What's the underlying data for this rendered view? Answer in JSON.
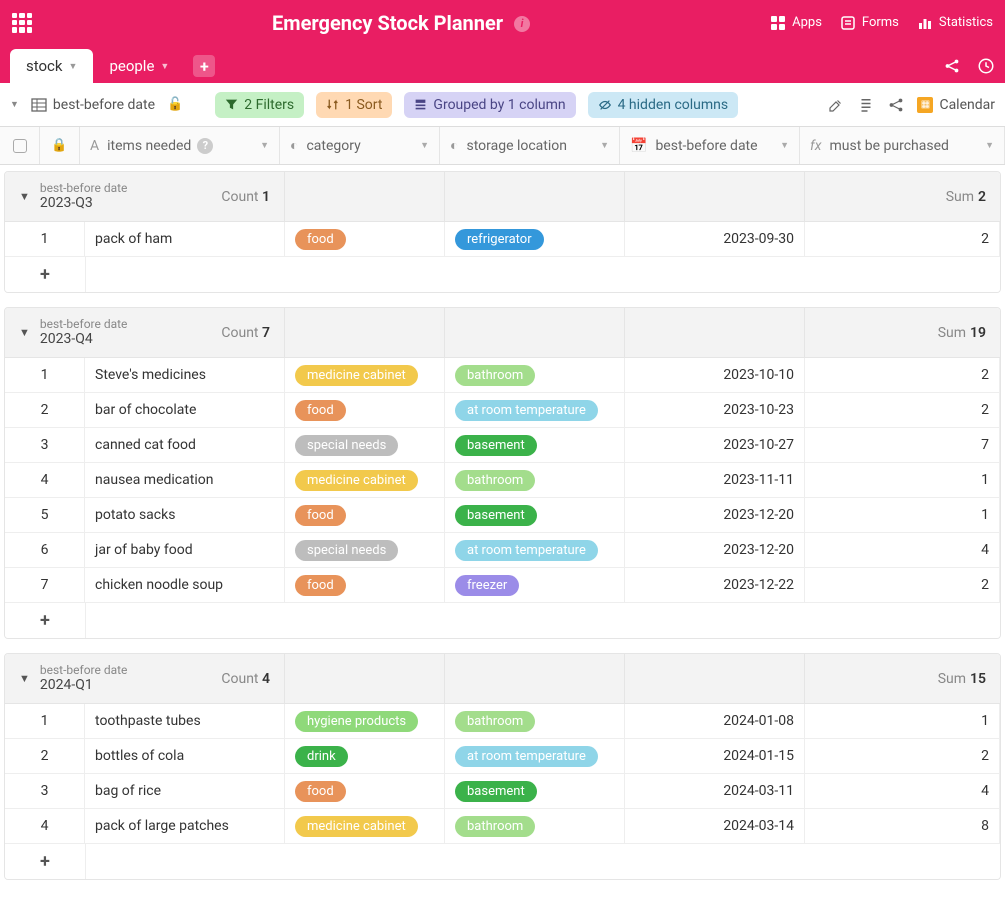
{
  "header": {
    "title": "Emergency Stock Planner",
    "links": {
      "apps": "Apps",
      "forms": "Forms",
      "stats": "Statistics"
    }
  },
  "tabs": {
    "stock": "stock",
    "people": "people"
  },
  "toolbar": {
    "view_name": "best-before date",
    "filters": "2 Filters",
    "sort": "1 Sort",
    "grouped": "Grouped by 1 column",
    "hidden": "4 hidden columns",
    "calendar": "Calendar"
  },
  "columns": {
    "items": "items needed",
    "category": "category",
    "storage": "storage location",
    "date": "best-before date",
    "purchased": "must be purchased"
  },
  "group_labels": {
    "field": "best-before date",
    "count": "Count",
    "sum": "Sum"
  },
  "tags": {
    "food": "food",
    "medicine_cabinet": "medicine cabinet",
    "special_needs": "special needs",
    "hygiene_products": "hygiene products",
    "drink": "drink",
    "refrigerator": "refrigerator",
    "bathroom": "bathroom",
    "at_room_temperature": "at room temperature",
    "basement": "basement",
    "freezer": "freezer"
  },
  "groups": [
    {
      "value": "2023-Q3",
      "count": "1",
      "sum": "2",
      "rows": [
        {
          "n": "1",
          "item": "pack of ham",
          "cat": "food",
          "catClass": "tag-food",
          "stor": "refrigerator",
          "storClass": "tag-refrigerator",
          "date": "2023-09-30",
          "pur": "2"
        }
      ]
    },
    {
      "value": "2023-Q4",
      "count": "7",
      "sum": "19",
      "rows": [
        {
          "n": "1",
          "item": "Steve's medicines",
          "cat": "medicine_cabinet",
          "catClass": "tag-medicine",
          "stor": "bathroom",
          "storClass": "tag-bathroom",
          "date": "2023-10-10",
          "pur": "2"
        },
        {
          "n": "2",
          "item": "bar of chocolate",
          "cat": "food",
          "catClass": "tag-food",
          "stor": "at_room_temperature",
          "storClass": "tag-roomtemp",
          "date": "2023-10-23",
          "pur": "2"
        },
        {
          "n": "3",
          "item": "canned cat food",
          "cat": "special_needs",
          "catClass": "tag-special",
          "stor": "basement",
          "storClass": "tag-basement",
          "date": "2023-10-27",
          "pur": "7"
        },
        {
          "n": "4",
          "item": "nausea medication",
          "cat": "medicine_cabinet",
          "catClass": "tag-medicine",
          "stor": "bathroom",
          "storClass": "tag-bathroom",
          "date": "2023-11-11",
          "pur": "1"
        },
        {
          "n": "5",
          "item": "potato sacks",
          "cat": "food",
          "catClass": "tag-food",
          "stor": "basement",
          "storClass": "tag-basement",
          "date": "2023-12-20",
          "pur": "1"
        },
        {
          "n": "6",
          "item": "jar of baby food",
          "cat": "special_needs",
          "catClass": "tag-special",
          "stor": "at_room_temperature",
          "storClass": "tag-roomtemp",
          "date": "2023-12-20",
          "pur": "4"
        },
        {
          "n": "7",
          "item": "chicken noodle soup",
          "cat": "food",
          "catClass": "tag-food",
          "stor": "freezer",
          "storClass": "tag-freezer",
          "date": "2023-12-22",
          "pur": "2"
        }
      ]
    },
    {
      "value": "2024-Q1",
      "count": "4",
      "sum": "15",
      "rows": [
        {
          "n": "1",
          "item": "toothpaste tubes",
          "cat": "hygiene_products",
          "catClass": "tag-hygiene",
          "stor": "bathroom",
          "storClass": "tag-bathroom",
          "date": "2024-01-08",
          "pur": "1"
        },
        {
          "n": "2",
          "item": "bottles of cola",
          "cat": "drink",
          "catClass": "tag-drink",
          "stor": "at_room_temperature",
          "storClass": "tag-roomtemp",
          "date": "2024-01-15",
          "pur": "2"
        },
        {
          "n": "3",
          "item": "bag of rice",
          "cat": "food",
          "catClass": "tag-food",
          "stor": "basement",
          "storClass": "tag-basement",
          "date": "2024-03-11",
          "pur": "4"
        },
        {
          "n": "4",
          "item": "pack of large patches",
          "cat": "medicine_cabinet",
          "catClass": "tag-medicine",
          "stor": "bathroom",
          "storClass": "tag-bathroom",
          "date": "2024-03-14",
          "pur": "8"
        }
      ]
    }
  ]
}
